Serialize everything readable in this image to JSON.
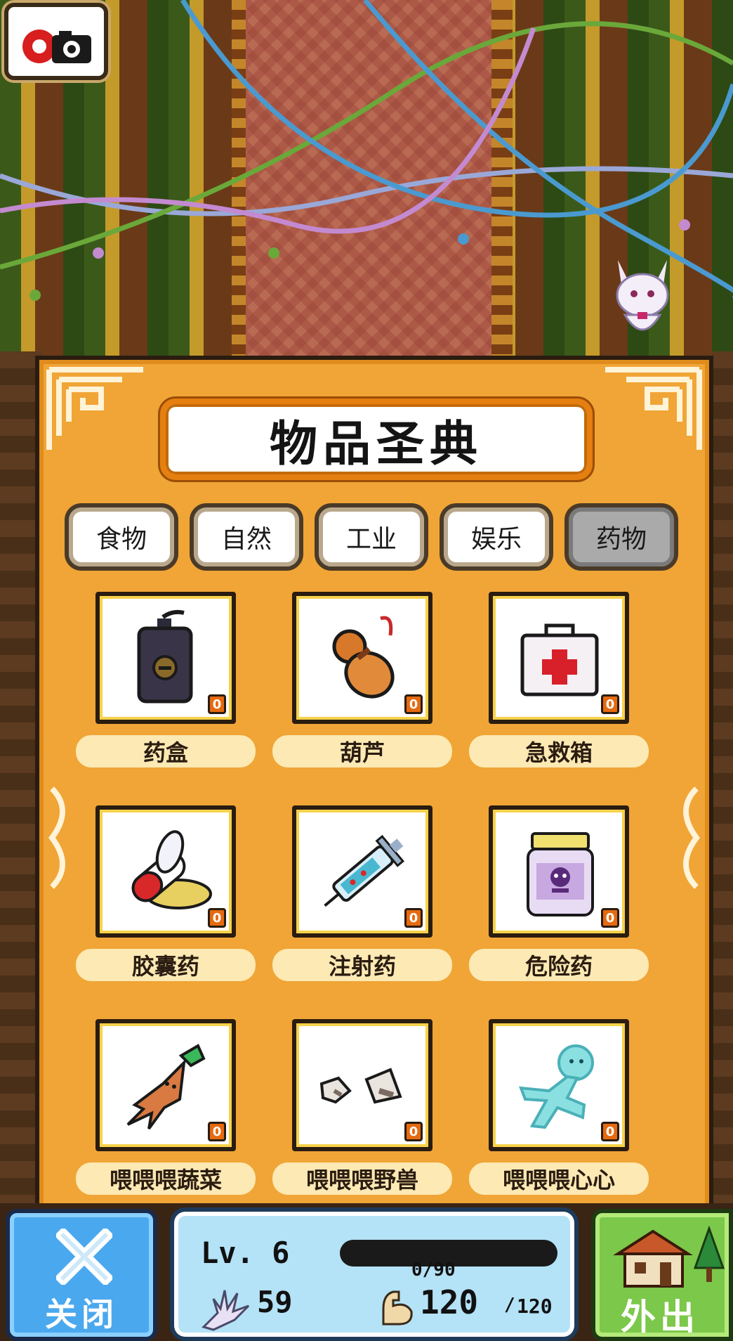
{
  "title": "物品圣典",
  "tabs": [
    {
      "label": "食物",
      "active": false
    },
    {
      "label": "自然",
      "active": false
    },
    {
      "label": "工业",
      "active": false
    },
    {
      "label": "娱乐",
      "active": false
    },
    {
      "label": "药物",
      "active": true
    }
  ],
  "items": [
    {
      "name": "药盒",
      "count": "0",
      "icon": "medicine-box-icon"
    },
    {
      "name": "葫芦",
      "count": "0",
      "icon": "gourd-icon"
    },
    {
      "name": "急救箱",
      "count": "0",
      "icon": "first-aid-kit-icon"
    },
    {
      "name": "胶囊药",
      "count": "0",
      "icon": "capsule-icon"
    },
    {
      "name": "注射药",
      "count": "0",
      "icon": "syringe-icon"
    },
    {
      "name": "危险药",
      "count": "0",
      "icon": "poison-jar-icon"
    },
    {
      "name": "喂喂喂蔬菜",
      "count": "0",
      "icon": "mandrake-icon"
    },
    {
      "name": "喂喂喂野兽",
      "count": "0",
      "icon": "fang-icon"
    },
    {
      "name": "喂喂喂心心",
      "count": "0",
      "icon": "jelly-figure-icon"
    }
  ],
  "bottom": {
    "close_label": "关闭",
    "level": "Lv. 6",
    "xp_text": "0/90",
    "xp_fraction": 0,
    "energy": "59",
    "strength_current": "120",
    "strength_sep": "/",
    "strength_max": "120",
    "out_label": "外出"
  },
  "colors": {
    "panel": "#f0a536",
    "tab_active": "#aaaaaa",
    "close_button": "#4aa8ee",
    "out_button": "#7cc84a",
    "count_badge": "#e66a10"
  }
}
